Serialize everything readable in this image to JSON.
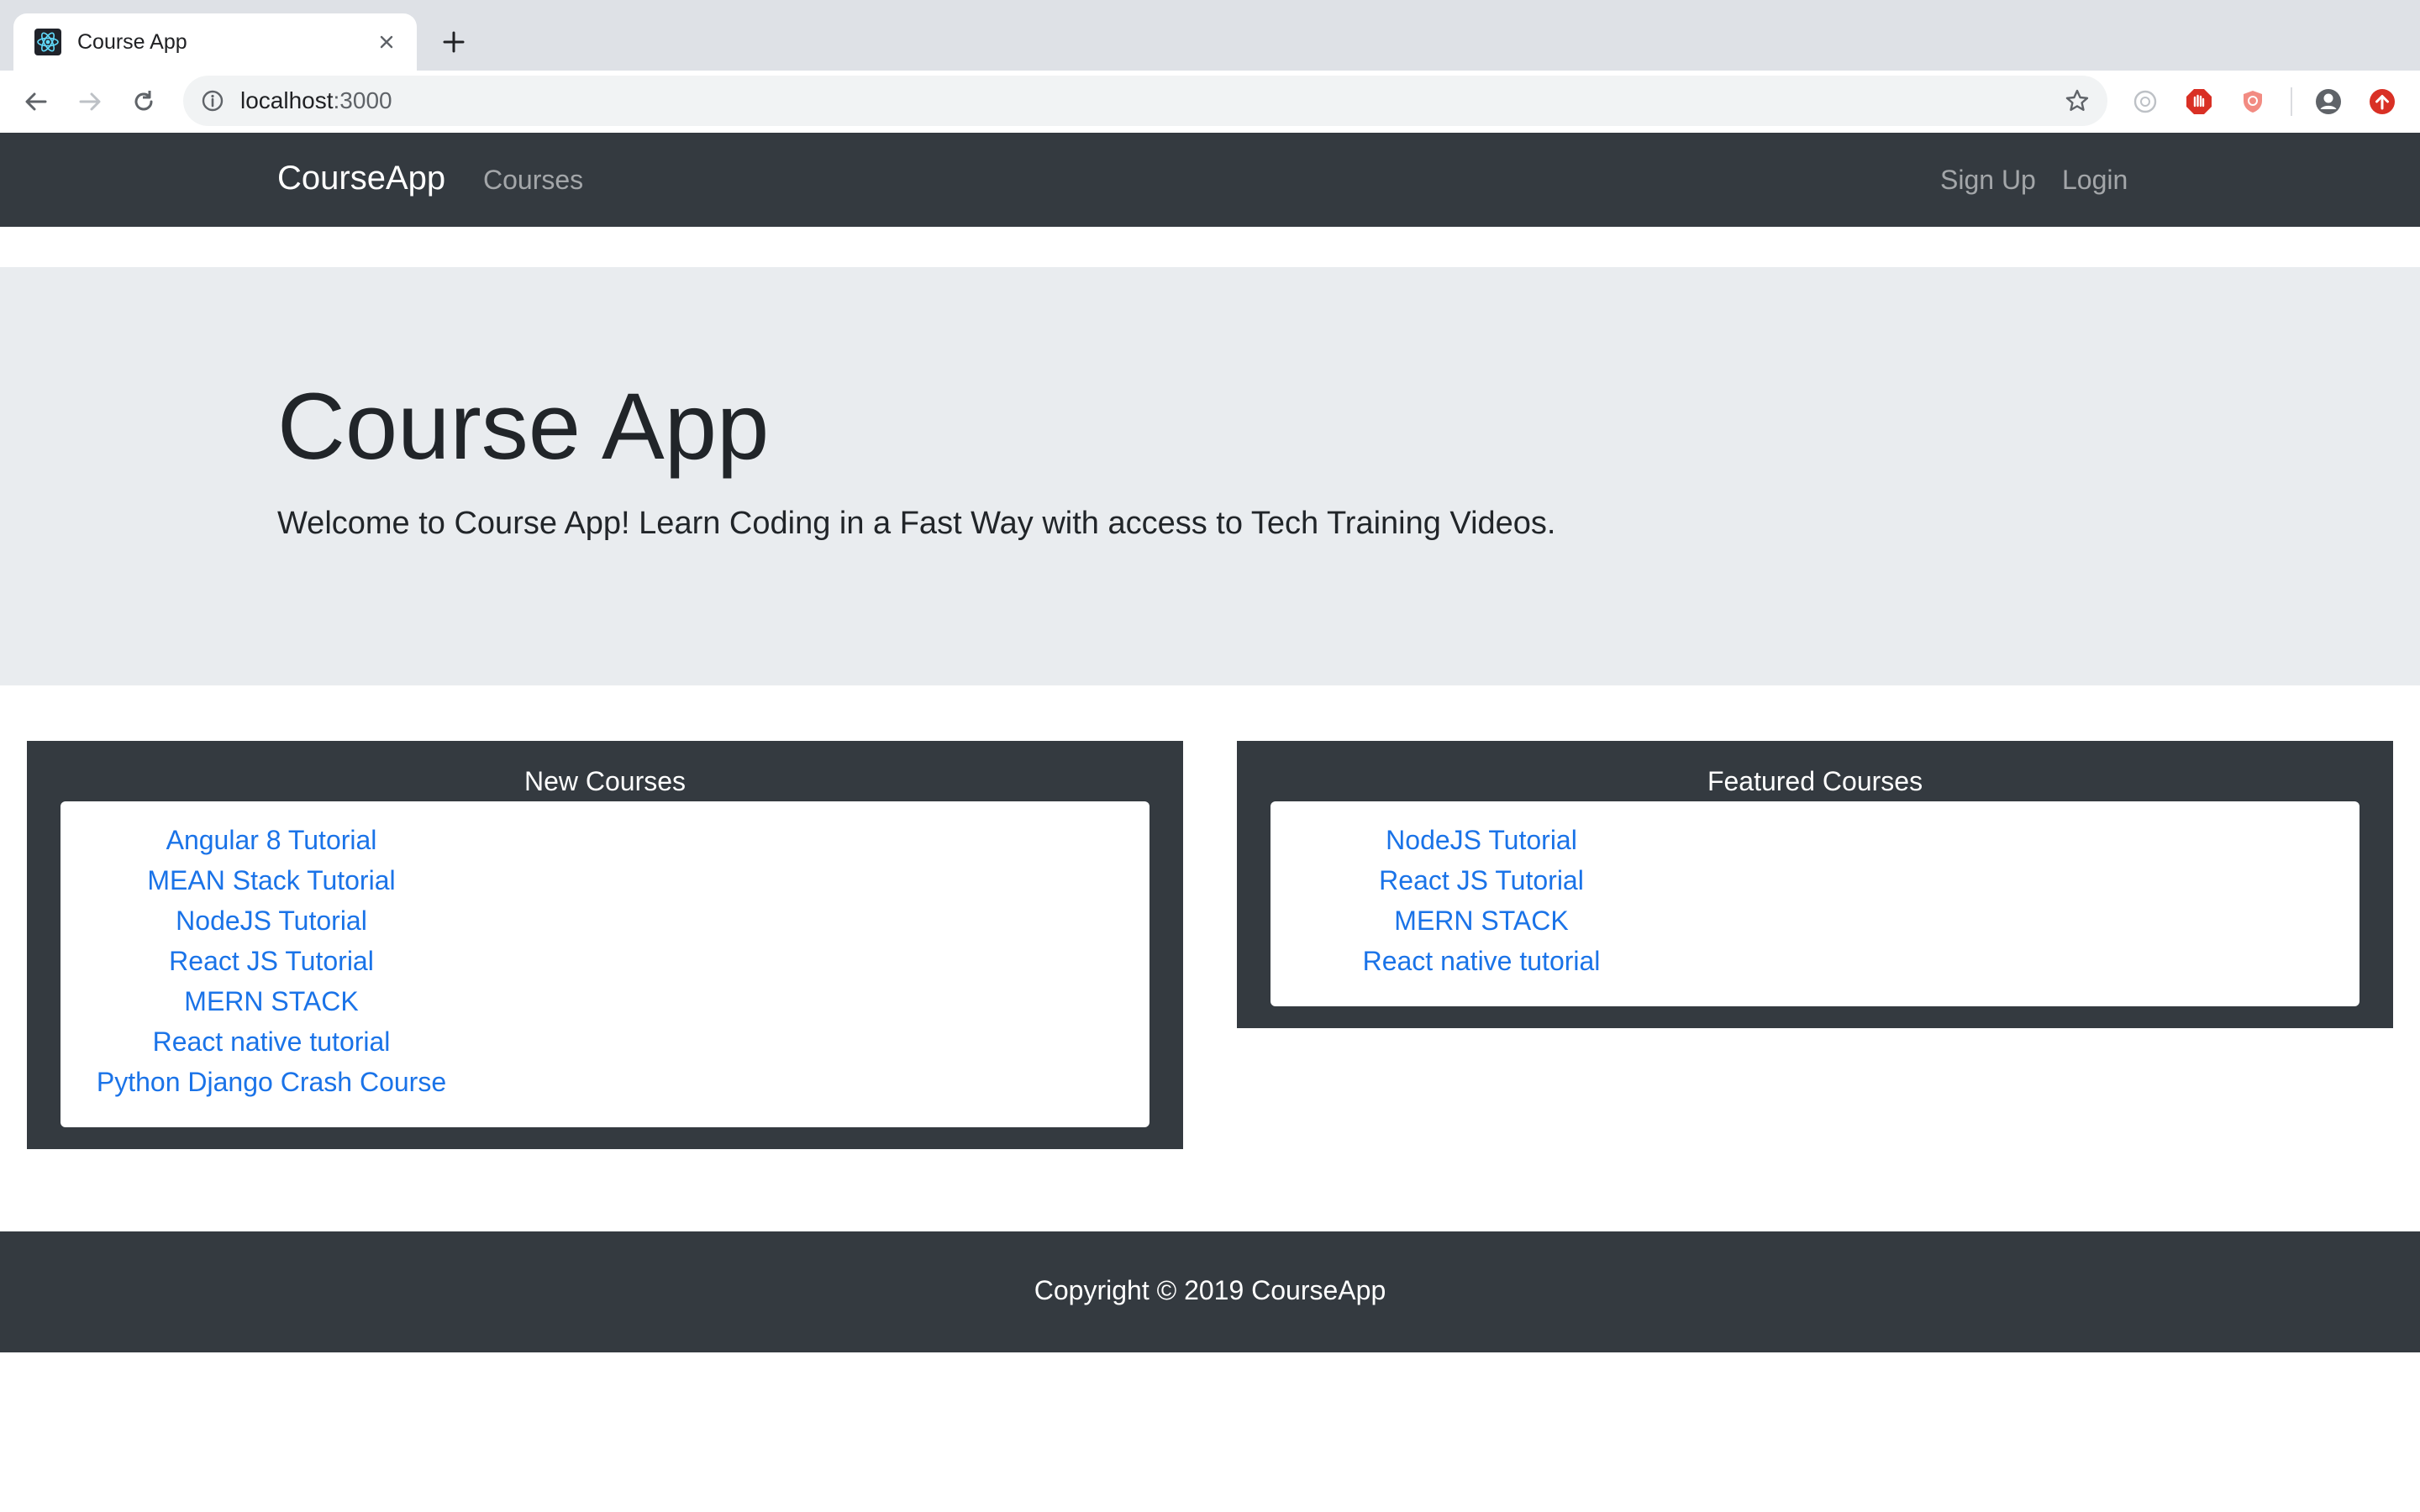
{
  "browser": {
    "tab": {
      "title": "Course App",
      "favicon": "react-icon",
      "close_icon": "close-icon"
    },
    "new_tab_icon": "plus-icon",
    "toolbar": {
      "back_icon": "back-arrow-icon",
      "forward_icon": "forward-arrow-icon",
      "reload_icon": "reload-icon",
      "url_host": "localhost",
      "url_port": ":3000",
      "info_icon": "info-icon",
      "star_icon": "bookmark-star-icon",
      "extensions": [
        "extension-circle-icon",
        "adblock-icon",
        "shield-icon",
        "profile-icon",
        "update-icon"
      ]
    }
  },
  "navbar": {
    "brand": "CourseApp",
    "links": [
      "Courses"
    ],
    "right_links": [
      "Sign Up",
      "Login"
    ]
  },
  "jumbotron": {
    "title": "Course App",
    "lead": "Welcome to Course App! Learn Coding in a Fast Way with access to Tech Training Videos."
  },
  "new_courses": {
    "header": "New Courses",
    "items": [
      "Angular 8 Tutorial",
      "MEAN Stack Tutorial",
      "NodeJS Tutorial",
      "React JS Tutorial",
      "MERN STACK",
      "React native tutorial",
      "Python Django Crash Course"
    ]
  },
  "featured_courses": {
    "header": "Featured Courses",
    "items": [
      "NodeJS Tutorial",
      "React JS Tutorial",
      "MERN STACK",
      "React native tutorial"
    ]
  },
  "footer": {
    "text": "Copyright © 2019 CourseApp"
  },
  "colors": {
    "dark": "#343a40",
    "jumbotron": "#e9ecef",
    "link": "#1a73e8"
  }
}
